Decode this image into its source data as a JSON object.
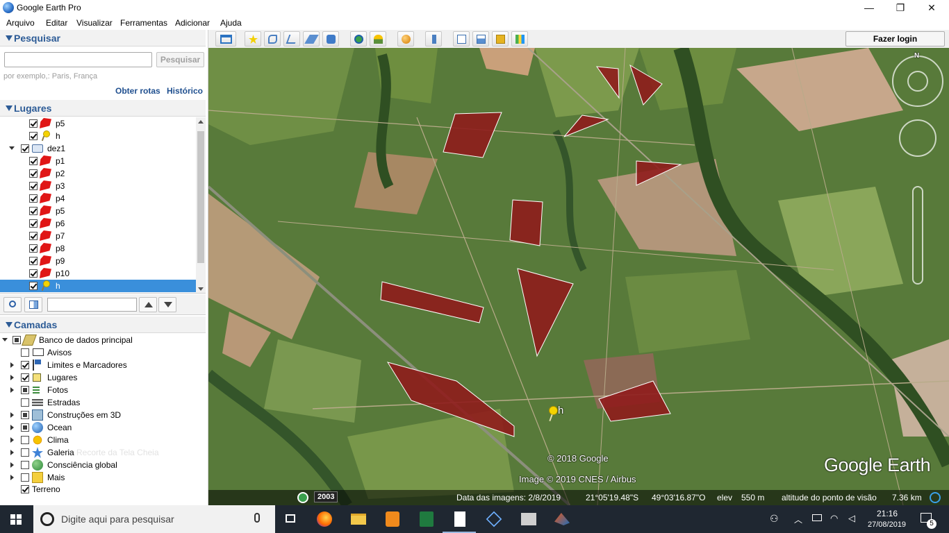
{
  "window": {
    "title": "Google Earth Pro",
    "minimize": "—",
    "maximize": "❐",
    "close": "✕"
  },
  "menu": [
    "Arquivo",
    "Editar",
    "Visualizar",
    "Ferramentas",
    "Adicionar",
    "Ajuda"
  ],
  "toolbar": {
    "login": "Fazer login",
    "icons": [
      "sidebar-toggle-icon",
      "placemark-icon",
      "polygon-icon",
      "path-icon",
      "overlay-icon",
      "tour-icon",
      "historical-imagery-icon",
      "sunlight-icon",
      "planets-icon",
      "ruler-icon",
      "email-icon",
      "print-icon",
      "save-image-icon",
      "maps-icon"
    ]
  },
  "search": {
    "title": "Pesquisar",
    "placeholder": "",
    "button": "Pesquisar",
    "hint": "por exemplo,: Paris, França",
    "routes": "Obter rotas",
    "history": "Histórico"
  },
  "places": {
    "title": "Lugares",
    "items": [
      {
        "label": "p5",
        "type": "polygon",
        "level": 2,
        "checked": true
      },
      {
        "label": "h",
        "type": "pin",
        "level": 2,
        "checked": true
      },
      {
        "label": "dez1",
        "type": "folder",
        "level": 1,
        "checked": true
      },
      {
        "label": "p1",
        "type": "polygon",
        "level": 2,
        "checked": true
      },
      {
        "label": "p2",
        "type": "polygon",
        "level": 2,
        "checked": true
      },
      {
        "label": "p3",
        "type": "polygon",
        "level": 2,
        "checked": true
      },
      {
        "label": "p4",
        "type": "polygon",
        "level": 2,
        "checked": true
      },
      {
        "label": "p5",
        "type": "polygon",
        "level": 2,
        "checked": true
      },
      {
        "label": "p6",
        "type": "polygon",
        "level": 2,
        "checked": true
      },
      {
        "label": "p7",
        "type": "polygon",
        "level": 2,
        "checked": true
      },
      {
        "label": "p8",
        "type": "polygon",
        "level": 2,
        "checked": true
      },
      {
        "label": "p9",
        "type": "polygon",
        "level": 2,
        "checked": true
      },
      {
        "label": "p10",
        "type": "polygon",
        "level": 2,
        "checked": true
      },
      {
        "label": "h",
        "type": "pin",
        "level": 2,
        "checked": true,
        "selected": true
      }
    ]
  },
  "layers": {
    "title": "Camadas",
    "items": [
      {
        "label": "Banco de dados principal",
        "icon": "database-icon",
        "state": "partial",
        "expander": "down",
        "level": 0
      },
      {
        "label": "Avisos",
        "icon": "envelope-icon",
        "state": "off",
        "expander": "",
        "level": 1
      },
      {
        "label": "Limites e Marcadores",
        "icon": "flag-icon",
        "state": "on",
        "expander": "right",
        "level": 1
      },
      {
        "label": "Lugares",
        "icon": "places-icon",
        "state": "on",
        "expander": "right",
        "level": 1
      },
      {
        "label": "Fotos",
        "icon": "photo-icon",
        "state": "partial",
        "expander": "right",
        "level": 1
      },
      {
        "label": "Estradas",
        "icon": "roads-icon",
        "state": "off",
        "expander": "",
        "level": 1
      },
      {
        "label": "Construções em 3D",
        "icon": "buildings-3d-icon",
        "state": "partial",
        "expander": "right",
        "level": 1
      },
      {
        "label": "Ocean",
        "icon": "ocean-icon",
        "state": "partial",
        "expander": "right",
        "level": 1
      },
      {
        "label": "Clima",
        "icon": "weather-icon",
        "state": "off",
        "expander": "right",
        "level": 1
      },
      {
        "label": "Galeria",
        "icon": "gallery-star-icon",
        "state": "off",
        "expander": "right",
        "level": 1
      },
      {
        "label": "Consciência global",
        "icon": "globe-icon",
        "state": "off",
        "expander": "right",
        "level": 1
      },
      {
        "label": "Mais",
        "icon": "more-icon",
        "state": "off",
        "expander": "right",
        "level": 1
      },
      {
        "label": "Terreno",
        "icon": "",
        "state": "on",
        "expander": "",
        "level": 0
      }
    ],
    "ghost_tooltip": "Recorte da Tela Cheia"
  },
  "map": {
    "placemark_label": "h",
    "copyright": "© 2018 Google",
    "image_credit": "Image © 2019 CNES / Airbus",
    "logo": "Google Earth",
    "compass_north": "N",
    "year_badge": "2003",
    "status": {
      "date": "Data das imagens: 2/8/2019",
      "lat": "21°05'19.48\"S",
      "lon": "49°03'16.87\"O",
      "elev_label": "elev",
      "elev": "550 m",
      "alt_label": "altitude do ponto de visão",
      "alt": "7.36 km"
    }
  },
  "taskbar": {
    "search_placeholder": "Digite aqui para pesquisar",
    "time": "21:16",
    "date": "27/08/2019",
    "notifications": "5",
    "apps": [
      "task-view-icon",
      "firefox-icon",
      "file-explorer-icon",
      "sublime-icon",
      "excel-icon",
      "notepad-icon",
      "virtualbox-icon",
      "mp-icon",
      "matlab-icon"
    ]
  },
  "colors": {
    "accent": "#2c5b96",
    "polygon_fill": "#8f1c1c",
    "selection": "#3a8fdb",
    "taskbar": "#1f2731"
  }
}
